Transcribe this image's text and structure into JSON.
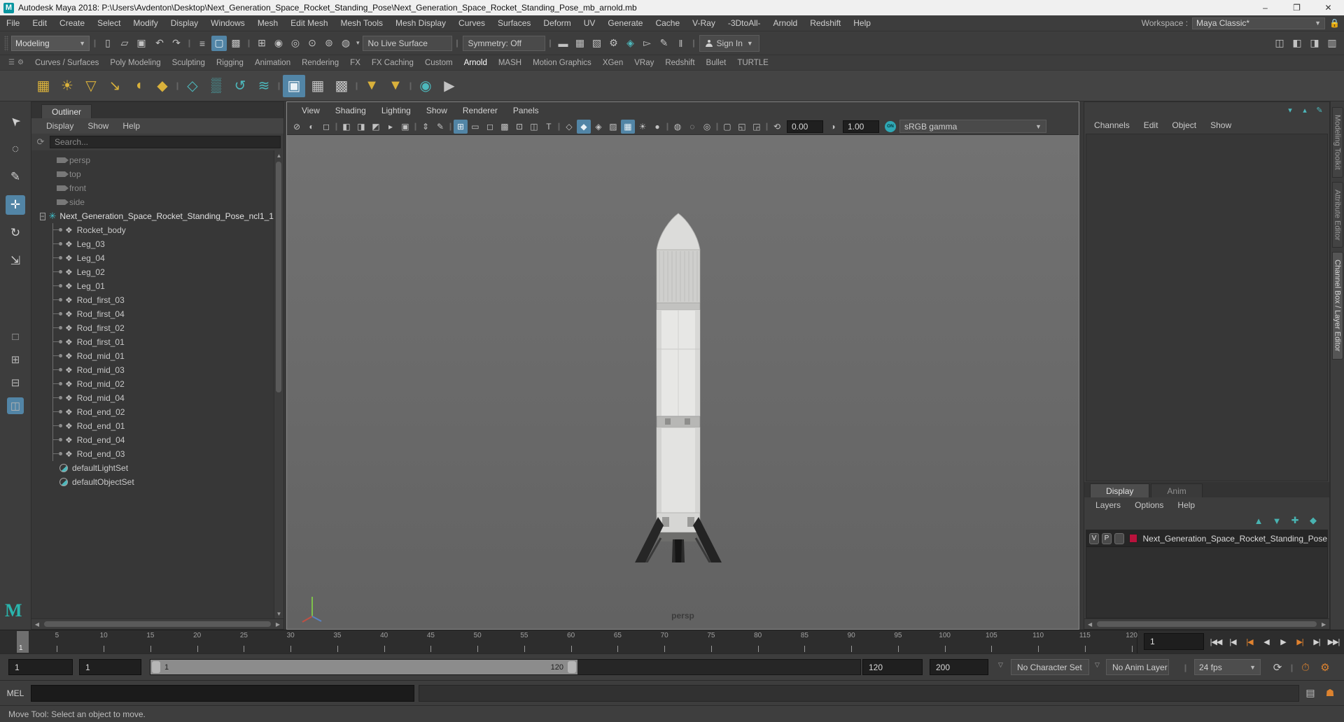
{
  "window": {
    "title": "Autodesk Maya 2018: P:\\Users\\Avdenton\\Desktop\\Next_Generation_Space_Rocket_Standing_Pose\\Next_Generation_Space_Rocket_Standing_Pose_mb_arnold.mb",
    "minimize": "–",
    "maximize": "❐",
    "close": "✕",
    "app_initial": "M"
  },
  "menubar": {
    "items": [
      "File",
      "Edit",
      "Create",
      "Select",
      "Modify",
      "Display",
      "Windows",
      "Mesh",
      "Edit Mesh",
      "Mesh Tools",
      "Mesh Display",
      "Curves",
      "Surfaces",
      "Deform",
      "UV",
      "Generate",
      "Cache",
      "V-Ray",
      "-3DtoAll-",
      "Arnold",
      "Redshift",
      "Help"
    ],
    "workspace_label": "Workspace :",
    "workspace_value": "Maya Classic*"
  },
  "statusline": {
    "mode_selector": "Modeling",
    "icons_file": [
      "new-scene",
      "open-scene",
      "save-scene"
    ],
    "icons_undo": [
      "undo",
      "redo"
    ],
    "icons_select": [
      "select-hierarchy",
      "select-object*",
      "select-component"
    ],
    "icons_snap": [
      "snap-grid",
      "snap-curve",
      "snap-point",
      "snap-projected",
      "snap-view-plane",
      "make-live"
    ],
    "live_surface": "No Live Surface",
    "symmetry": "Symmetry: Off",
    "icons_render": [
      "render-frame",
      "ipr-render",
      "render-region",
      "render-settings",
      "hypershade",
      "light-editor",
      "paint-effects",
      "pause-viewport"
    ],
    "sign_in": "Sign In",
    "icons_panels": [
      "modeling-toolkit-toggle",
      "humanik-toggle",
      "attribute-editor-toggle",
      "channel-box-toggle"
    ]
  },
  "shelf": {
    "active_tab": "Arnold",
    "tabs": [
      "Curves / Surfaces",
      "Poly Modeling",
      "Sculpting",
      "Rigging",
      "Animation",
      "Rendering",
      "FX",
      "FX Caching",
      "Custom",
      "Arnold",
      "MASH",
      "Motion Graphics",
      "XGen",
      "VRay",
      "Redshift",
      "Bullet",
      "TURTLE"
    ],
    "icons": [
      "area-light",
      "point-light",
      "spot-light",
      "directional-light",
      "skydome-light",
      "mesh-light",
      "|",
      "standin",
      "volume",
      "operator-graph",
      "flush-cache",
      "|",
      "render-view*",
      "ipr-render-shelf",
      "render-stop",
      "|",
      "export-standin",
      "export-selected",
      "|",
      "tx-manager",
      "render-sequence"
    ]
  },
  "toolbox": {
    "tools": [
      "select-tool",
      "lasso-tool",
      "paint-select-tool",
      "move-tool*",
      "rotate-tool",
      "scale-tool"
    ],
    "layouts": [
      "single-pane-layout",
      "four-pane-layout",
      "two-pane-layout",
      "persp-outliner-layout*"
    ]
  },
  "outliner": {
    "panel_title": "Outliner",
    "menus": [
      "Display",
      "Show",
      "Help"
    ],
    "search_placeholder": "Search...",
    "cameras": [
      "persp",
      "top",
      "front",
      "side"
    ],
    "group_label": "Next_Generation_Space_Rocket_Standing_Pose_ncl1_1",
    "children": [
      "Rocket_body",
      "Leg_03",
      "Leg_04",
      "Leg_02",
      "Leg_01",
      "Rod_first_03",
      "Rod_first_04",
      "Rod_first_02",
      "Rod_first_01",
      "Rod_mid_01",
      "Rod_mid_03",
      "Rod_mid_02",
      "Rod_mid_04",
      "Rod_end_02",
      "Rod_end_01",
      "Rod_end_04",
      "Rod_end_03"
    ],
    "sets": [
      "defaultLightSet",
      "defaultObjectSet"
    ]
  },
  "viewport": {
    "menus": [
      "View",
      "Shading",
      "Lighting",
      "Show",
      "Renderer",
      "Panels"
    ],
    "icons": [
      "no-live-select",
      "dim-sphere",
      "dim-box",
      "|",
      "select-camera",
      "lock-camera",
      "camera-attributes",
      "bookmark",
      "image-plane",
      "|",
      "pan-zoom",
      "grease-pencil",
      "|",
      "grid*",
      "film-gate",
      "resolution-gate",
      "gate-mask",
      "field-chart",
      "safe-action",
      "safe-title",
      "|",
      "wireframe",
      "smooth-shade*",
      "wireframe-on-shaded",
      "textured",
      "default-material*",
      "lighting",
      "shadows",
      "|",
      "occlusion",
      "motion-blur",
      "isolate-select",
      "|",
      "object-marquee",
      "increase-manip",
      "decrease-manip",
      "|",
      "exposure"
    ],
    "exposure_value": "0.00",
    "contrast_value": "1.00",
    "gamma_on": "ON",
    "gamma_mode": "sRGB gamma",
    "camera_label": "persp"
  },
  "channel_box": {
    "menus": [
      "Channels",
      "Edit",
      "Object",
      "Show"
    ],
    "icons": [
      "speed-slow",
      "speed-fast",
      "channel-edit"
    ]
  },
  "side_tabs": {
    "items": [
      "Modeling Toolkit",
      "Attribute Editor",
      "Channel Box / Layer Editor"
    ],
    "active": "Channel Box / Layer Editor"
  },
  "layer_editor": {
    "tabs": [
      "Display",
      "Anim"
    ],
    "active_tab": "Display",
    "menus": [
      "Layers",
      "Options",
      "Help"
    ],
    "icons": [
      "move-layer-up",
      "move-layer-down",
      "empty-layer",
      "new-layer-selected"
    ],
    "layer_row": {
      "visibility": "V",
      "playback": "P",
      "color": "#b8123c",
      "name": "Next_Generation_Space_Rocket_Standing_Pose"
    }
  },
  "timeline": {
    "playhead": "1",
    "tick_labels": [
      5,
      10,
      15,
      20,
      25,
      30,
      35,
      40,
      45,
      50,
      55,
      60,
      65,
      70,
      75,
      80,
      85,
      90,
      95,
      100,
      105,
      110,
      115,
      120
    ],
    "current_time": "1",
    "playback_buttons": [
      "go-to-start",
      "step-back-frame",
      "step-back-key*",
      "play-backwards",
      "play-forwards",
      "step-forward-key*",
      "step-forward-frame",
      "go-to-end"
    ]
  },
  "range_slider": {
    "animation_start": "1",
    "playback_start": "1",
    "bar_start_label": "1",
    "bar_end_label": "120",
    "playback_end": "120",
    "animation_end": "200",
    "character_set": "No Character Set",
    "anim_layer": "No Anim Layer",
    "fps": "24 fps",
    "icons": [
      "loop-playback",
      "auto-keyframe",
      "animation-preferences"
    ]
  },
  "command_line": {
    "label": "MEL"
  },
  "help_line": {
    "message": "Move Tool: Select an object to move."
  },
  "colors": {
    "accent_blue": "#5285a6",
    "teal": "#4db8bc",
    "yellow": "#d9b13b",
    "orange": "#dd832f",
    "layer_red": "#b8123c",
    "viewport_gray": "#6a6a6a"
  }
}
